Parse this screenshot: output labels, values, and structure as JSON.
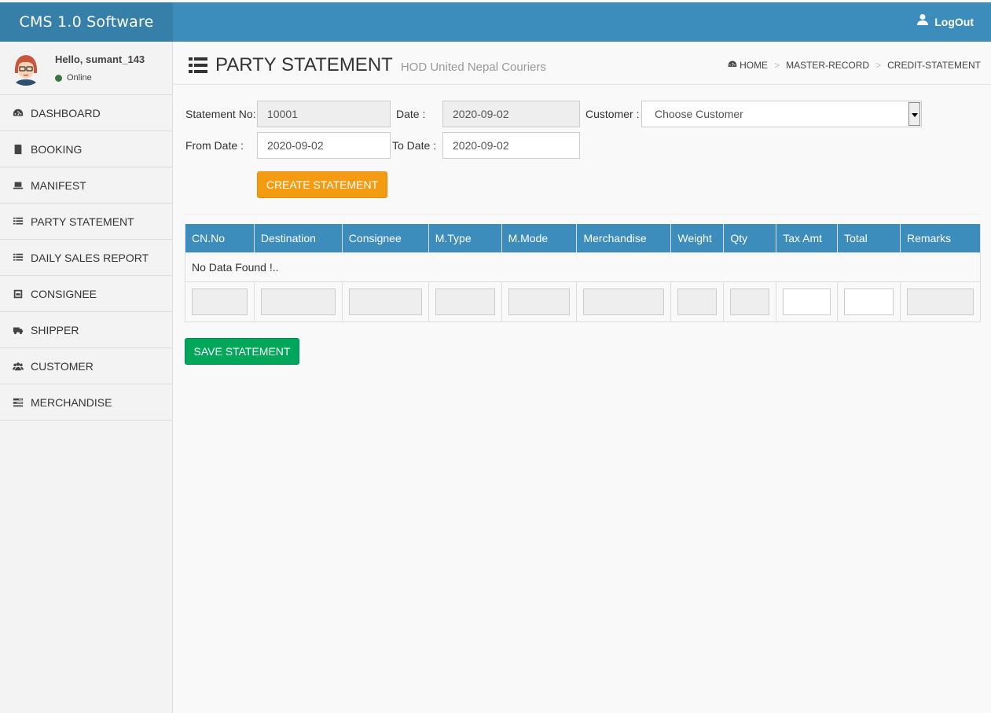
{
  "app": {
    "title": "CMS 1.0 Software"
  },
  "header": {
    "logout_label": "LogOut"
  },
  "user": {
    "greeting": "Hello, sumant_143",
    "status": "Online"
  },
  "sidebar": {
    "items": [
      {
        "label": "DASHBOARD",
        "icon": "dashboard-icon"
      },
      {
        "label": "BOOKING",
        "icon": "book-icon"
      },
      {
        "label": "MANIFEST",
        "icon": "laptop-icon"
      },
      {
        "label": "PARTY STATEMENT",
        "icon": "list-icon"
      },
      {
        "label": "DAILY SALES REPORT",
        "icon": "list-icon"
      },
      {
        "label": "CONSIGNEE",
        "icon": "box-icon"
      },
      {
        "label": "SHIPPER",
        "icon": "truck-icon"
      },
      {
        "label": "CUSTOMER",
        "icon": "users-icon"
      },
      {
        "label": "MERCHANDISE",
        "icon": "tasks-icon"
      }
    ]
  },
  "page": {
    "title": "PARTY STATEMENT",
    "subtitle": "HOD United Nepal Couriers"
  },
  "breadcrumb": {
    "items": [
      "HOME",
      "MASTER-RECORD",
      "CREDIT-STATEMENT"
    ],
    "separator": ">"
  },
  "form": {
    "statement_no_label": "Statement No:",
    "statement_no_value": "10001",
    "date_label": "Date :",
    "date_value": "2020-09-02",
    "customer_label": "Customer :",
    "customer_value": "Choose Customer",
    "from_date_label": "From Date :",
    "from_date_value": "2020-09-02",
    "to_date_label": "To Date :",
    "to_date_value": "2020-09-02",
    "create_button": "CREATE STATEMENT"
  },
  "table": {
    "columns": [
      "CN.No",
      "Destination",
      "Consignee",
      "M.Type",
      "M.Mode",
      "Merchandise",
      "Weight",
      "Qty",
      "Tax Amt",
      "Total",
      "Remarks"
    ],
    "empty_text": "No Data Found !.."
  },
  "save_button": "SAVE STATEMENT",
  "colors": {
    "header": "#3c8dbc",
    "logo": "#367fa9",
    "create_button": "#f39c12",
    "save_button": "#00a65a"
  }
}
